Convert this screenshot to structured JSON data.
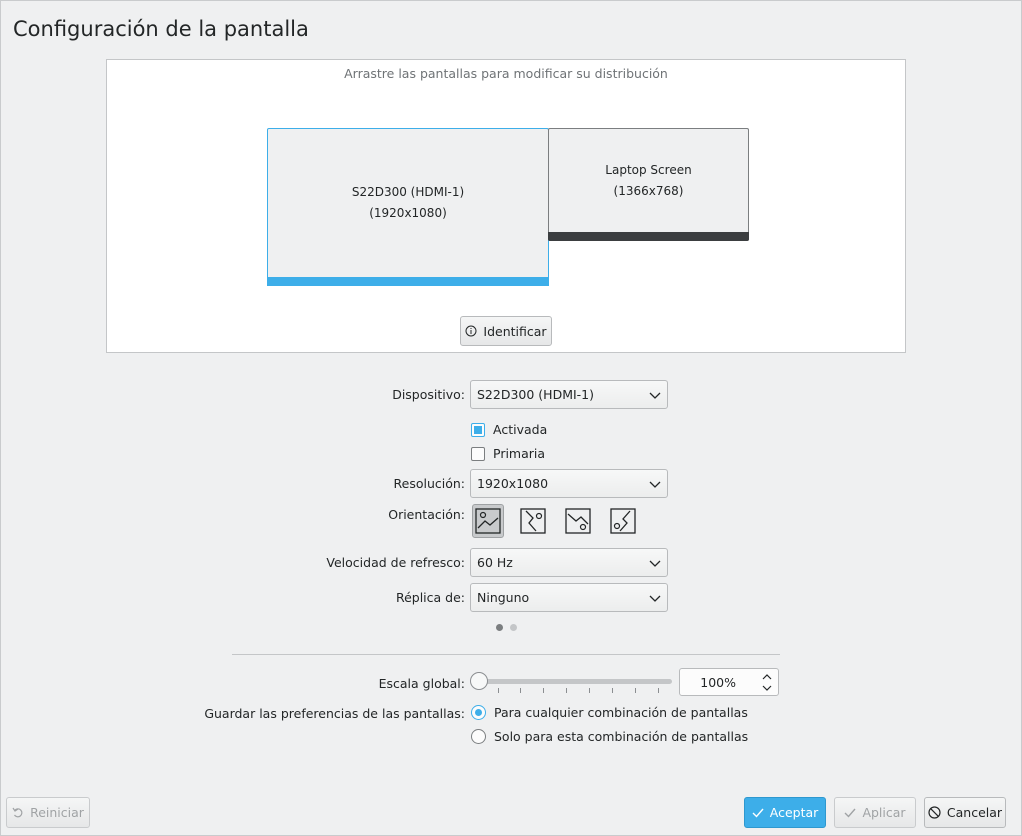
{
  "window": {
    "title": "Configuración de la pantalla"
  },
  "layout": {
    "hint": "Arrastre las pantallas para modificar su distribución",
    "monitors": [
      {
        "name": "S22D300 (HDMI-1)",
        "resolution": "(1920x1080)",
        "selected": true
      },
      {
        "name": "Laptop Screen",
        "resolution": "(1366x768)",
        "selected": false
      }
    ],
    "identify_label": "Identificar"
  },
  "form": {
    "device_label": "Dispositivo:",
    "device_value": "S22D300 (HDMI-1)",
    "enabled_label": "Activada",
    "enabled_checked": true,
    "primary_label": "Primaria",
    "primary_checked": false,
    "resolution_label": "Resolución:",
    "resolution_value": "1920x1080",
    "orientation_label": "Orientación:",
    "orientation_icons": [
      "landscape-icon",
      "portrait-left-icon",
      "inverted-landscape-icon",
      "portrait-right-icon"
    ],
    "orientation_selected": 0,
    "refresh_label": "Velocidad de refresco:",
    "refresh_value": "60 Hz",
    "replica_label": "Réplica de:",
    "replica_value": "Ninguno",
    "page_indicator": {
      "pages": 2,
      "current": 1
    }
  },
  "scale": {
    "label": "Escala global:",
    "value": "100%",
    "slider_fraction": 0.0
  },
  "save_prefs": {
    "label": "Guardar las preferencias de las pantallas:",
    "options": [
      "Para cualquier combinación de pantallas",
      "Solo para esta combinación de pantallas"
    ],
    "selected": 0
  },
  "buttons": {
    "reset": "Reiniciar",
    "accept": "Aceptar",
    "apply": "Aplicar",
    "cancel": "Cancelar"
  },
  "colors": {
    "accent": "#3daee9",
    "background": "#eff0f1",
    "laptop_bar": "#3b3e40"
  }
}
